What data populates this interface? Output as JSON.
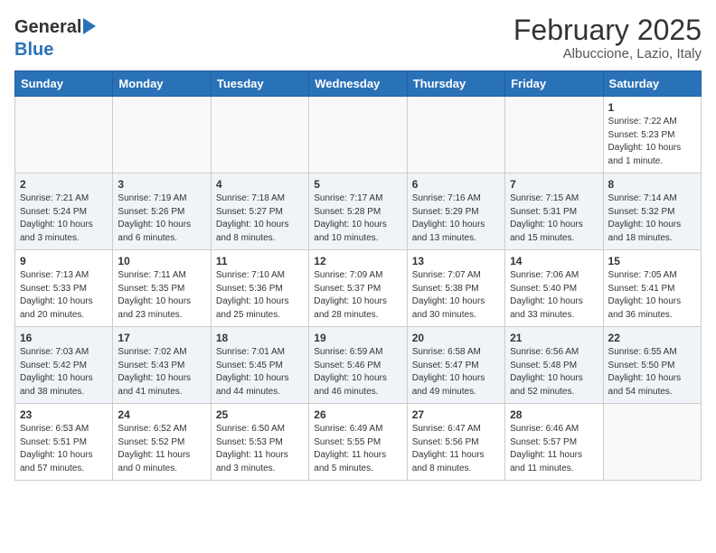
{
  "header": {
    "logo_general": "General",
    "logo_blue": "Blue",
    "month_title": "February 2025",
    "location": "Albuccione, Lazio, Italy"
  },
  "weekdays": [
    "Sunday",
    "Monday",
    "Tuesday",
    "Wednesday",
    "Thursday",
    "Friday",
    "Saturday"
  ],
  "weeks": [
    [
      {
        "day": "",
        "info": ""
      },
      {
        "day": "",
        "info": ""
      },
      {
        "day": "",
        "info": ""
      },
      {
        "day": "",
        "info": ""
      },
      {
        "day": "",
        "info": ""
      },
      {
        "day": "",
        "info": ""
      },
      {
        "day": "1",
        "info": "Sunrise: 7:22 AM\nSunset: 5:23 PM\nDaylight: 10 hours and 1 minute."
      }
    ],
    [
      {
        "day": "2",
        "info": "Sunrise: 7:21 AM\nSunset: 5:24 PM\nDaylight: 10 hours and 3 minutes."
      },
      {
        "day": "3",
        "info": "Sunrise: 7:19 AM\nSunset: 5:26 PM\nDaylight: 10 hours and 6 minutes."
      },
      {
        "day": "4",
        "info": "Sunrise: 7:18 AM\nSunset: 5:27 PM\nDaylight: 10 hours and 8 minutes."
      },
      {
        "day": "5",
        "info": "Sunrise: 7:17 AM\nSunset: 5:28 PM\nDaylight: 10 hours and 10 minutes."
      },
      {
        "day": "6",
        "info": "Sunrise: 7:16 AM\nSunset: 5:29 PM\nDaylight: 10 hours and 13 minutes."
      },
      {
        "day": "7",
        "info": "Sunrise: 7:15 AM\nSunset: 5:31 PM\nDaylight: 10 hours and 15 minutes."
      },
      {
        "day": "8",
        "info": "Sunrise: 7:14 AM\nSunset: 5:32 PM\nDaylight: 10 hours and 18 minutes."
      }
    ],
    [
      {
        "day": "9",
        "info": "Sunrise: 7:13 AM\nSunset: 5:33 PM\nDaylight: 10 hours and 20 minutes."
      },
      {
        "day": "10",
        "info": "Sunrise: 7:11 AM\nSunset: 5:35 PM\nDaylight: 10 hours and 23 minutes."
      },
      {
        "day": "11",
        "info": "Sunrise: 7:10 AM\nSunset: 5:36 PM\nDaylight: 10 hours and 25 minutes."
      },
      {
        "day": "12",
        "info": "Sunrise: 7:09 AM\nSunset: 5:37 PM\nDaylight: 10 hours and 28 minutes."
      },
      {
        "day": "13",
        "info": "Sunrise: 7:07 AM\nSunset: 5:38 PM\nDaylight: 10 hours and 30 minutes."
      },
      {
        "day": "14",
        "info": "Sunrise: 7:06 AM\nSunset: 5:40 PM\nDaylight: 10 hours and 33 minutes."
      },
      {
        "day": "15",
        "info": "Sunrise: 7:05 AM\nSunset: 5:41 PM\nDaylight: 10 hours and 36 minutes."
      }
    ],
    [
      {
        "day": "16",
        "info": "Sunrise: 7:03 AM\nSunset: 5:42 PM\nDaylight: 10 hours and 38 minutes."
      },
      {
        "day": "17",
        "info": "Sunrise: 7:02 AM\nSunset: 5:43 PM\nDaylight: 10 hours and 41 minutes."
      },
      {
        "day": "18",
        "info": "Sunrise: 7:01 AM\nSunset: 5:45 PM\nDaylight: 10 hours and 44 minutes."
      },
      {
        "day": "19",
        "info": "Sunrise: 6:59 AM\nSunset: 5:46 PM\nDaylight: 10 hours and 46 minutes."
      },
      {
        "day": "20",
        "info": "Sunrise: 6:58 AM\nSunset: 5:47 PM\nDaylight: 10 hours and 49 minutes."
      },
      {
        "day": "21",
        "info": "Sunrise: 6:56 AM\nSunset: 5:48 PM\nDaylight: 10 hours and 52 minutes."
      },
      {
        "day": "22",
        "info": "Sunrise: 6:55 AM\nSunset: 5:50 PM\nDaylight: 10 hours and 54 minutes."
      }
    ],
    [
      {
        "day": "23",
        "info": "Sunrise: 6:53 AM\nSunset: 5:51 PM\nDaylight: 10 hours and 57 minutes."
      },
      {
        "day": "24",
        "info": "Sunrise: 6:52 AM\nSunset: 5:52 PM\nDaylight: 11 hours and 0 minutes."
      },
      {
        "day": "25",
        "info": "Sunrise: 6:50 AM\nSunset: 5:53 PM\nDaylight: 11 hours and 3 minutes."
      },
      {
        "day": "26",
        "info": "Sunrise: 6:49 AM\nSunset: 5:55 PM\nDaylight: 11 hours and 5 minutes."
      },
      {
        "day": "27",
        "info": "Sunrise: 6:47 AM\nSunset: 5:56 PM\nDaylight: 11 hours and 8 minutes."
      },
      {
        "day": "28",
        "info": "Sunrise: 6:46 AM\nSunset: 5:57 PM\nDaylight: 11 hours and 11 minutes."
      },
      {
        "day": "",
        "info": ""
      }
    ]
  ]
}
